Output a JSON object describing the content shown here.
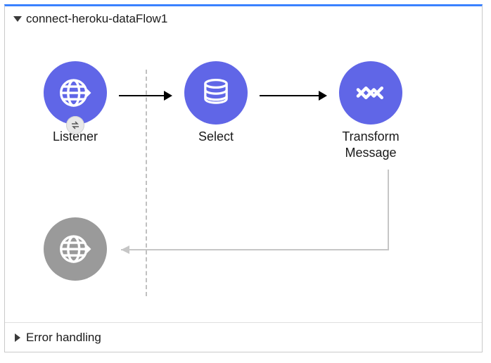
{
  "flow": {
    "title": "connect-heroku-dataFlow1",
    "footer": "Error handling",
    "nodes": {
      "listener": {
        "label": "Listener"
      },
      "select": {
        "label": "Select"
      },
      "transform": {
        "label": "Transform\nMessage"
      }
    }
  },
  "colors": {
    "accent": "#6066e7",
    "topbar": "#3a82ff",
    "grey": "#9a9a9a"
  }
}
